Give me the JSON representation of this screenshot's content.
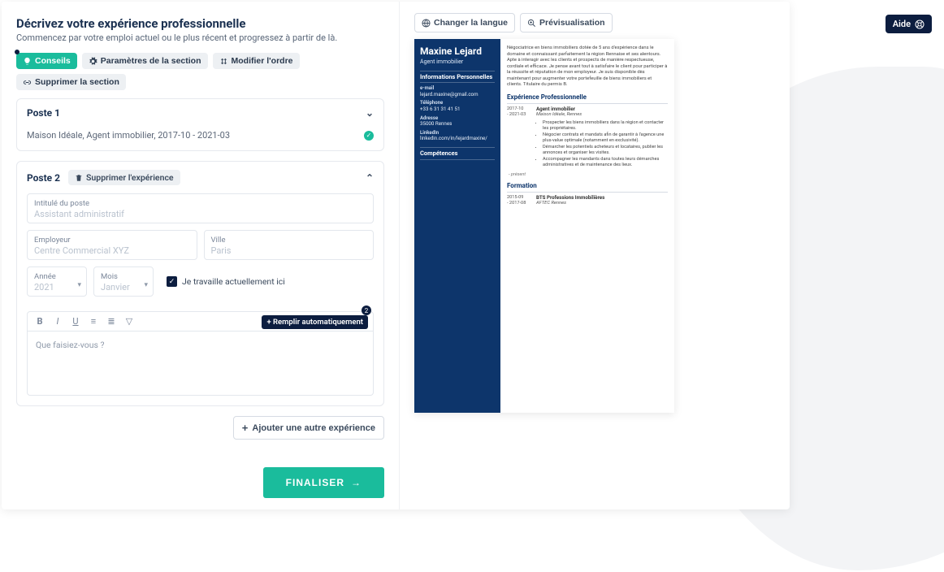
{
  "help_button": "Aide",
  "header": {
    "title": "Décrivez votre expérience professionnelle",
    "subtitle": "Commencez par votre emploi actuel ou le plus récent et progressez à partir de là."
  },
  "toolbar": {
    "tips": "Conseils",
    "section_settings": "Paramètres de la section",
    "reorder": "Modifier l'ordre",
    "delete_section": "Supprimer la section"
  },
  "poste1": {
    "title": "Poste 1",
    "summary": "Maison Idéale, Agent immobilier, 2017-10 - 2021-03"
  },
  "poste2": {
    "title": "Poste 2",
    "delete": "Supprimer l'expérience",
    "fields": {
      "job_title_label": "Intitulé du poste",
      "job_title_placeholder": "Assistant administratif",
      "employer_label": "Employeur",
      "employer_placeholder": "Centre Commercial XYZ",
      "city_label": "Ville",
      "city_placeholder": "Paris",
      "year_label": "Année",
      "year_value": "2021",
      "month_label": "Mois",
      "month_value": "Janvier",
      "current_label": "Je travaille actuellement ici"
    },
    "editor": {
      "autofill": "+ Remplir automatiquement",
      "placeholder": "Que faisiez-vous ?",
      "help_count": "2"
    }
  },
  "add_experience": "Ajouter une autre expérience",
  "finalize": "FINALISER",
  "preview_bar": {
    "language": "Changer la langue",
    "preview": "Prévisualisation"
  },
  "resume": {
    "name": "Maxine Lejard",
    "role": "Agent immobilier",
    "sections": {
      "personal": "Informations Personnelles",
      "skills": "Compétences",
      "experience": "Expérience Professionnelle",
      "education": "Formation"
    },
    "contact": {
      "email_label": "e-mail",
      "email": "lejard.maxine@gmail.com",
      "phone_label": "Téléphone",
      "phone": "+33 6 31 31 41 51",
      "address_label": "Adresse",
      "address": "35000 Rennes",
      "linkedin_label": "LinkedIn",
      "linkedin": "linkedin.com/in/lejardmaxine/"
    },
    "intro": "Négociatrice en biens immobiliers dotée de 5 ans d'expérience dans le domaine et connaissant parfaitement la région Rennaise et ses alentours. Apte à interagir avec les clients et prospects de manière respectueuse, cordiale et efficace. Je pense avant tout à satisfaire le client pour participer à la réussite et réputation de mon employeur. Je suis disponible dès maintenant pour augmenter votre portefeuille de biens immobiliers et clients. Titulaire du permis B.",
    "exp1": {
      "dates": "2017-10\n- 2021-03",
      "title": "Agent immobilier",
      "company": "Maison Idéale, Rennes",
      "bullets": [
        "Prospecter les biens immobiliers dans la région et contacter les propriétaires.",
        "Négocier contrats et mandats afin de garantir à l'agence une plus-value optimale (notamment en exclusivité).",
        "Démarcher les potentiels acheteurs et locataires, publier les annonces et organiser les visites.",
        "Accompagner les mandants dans toutes leurs démarches administratives et de maintenance des lieux."
      ]
    },
    "present": "- présent",
    "edu1": {
      "dates": "2015-09\n- 2017-08",
      "title": "BTS Professions Immobilières",
      "company": "AFTEC Rennes"
    }
  }
}
